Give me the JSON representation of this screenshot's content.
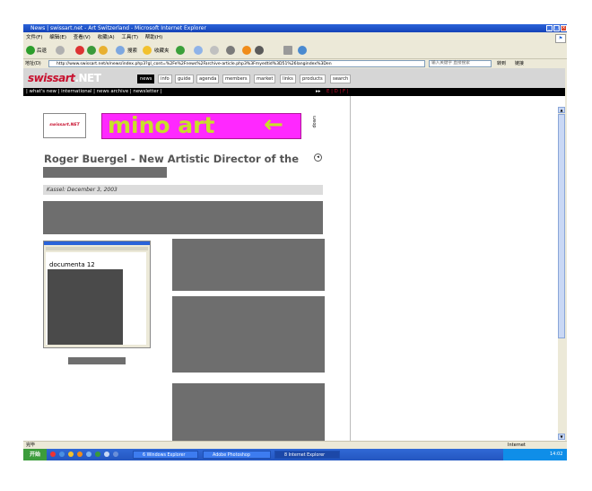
{
  "window": {
    "title": "News | swissart.net - Art Switzerland - Microsoft Internet Explorer"
  },
  "menu": [
    "文件(F)",
    "编辑(E)",
    "查看(V)",
    "收藏(A)",
    "工具(T)",
    "帮助(H)"
  ],
  "toolbar": {
    "back": "后退",
    "search": "搜索",
    "favorites": "收藏夹"
  },
  "address": {
    "label": "地址(D)",
    "url": "http://www.swissart.net/e/news/index.php3?gl_cont=%2Fe%2Fnews%2Farchive-article.php3%3Fmyedtid%3D51%26langindex%3Den",
    "search_placeholder": "输入关键字 直接搜索",
    "go": "转到",
    "links": "链接"
  },
  "site": {
    "logo_main": "swissart",
    "logo_ext": ".NET",
    "nav": [
      "news",
      "info",
      "guide",
      "agenda",
      "members",
      "market",
      "links",
      "products",
      "search"
    ],
    "subnav": "| what's new | international | news archive | newsletter |",
    "lang": "E | D | F |"
  },
  "article": {
    "small_logo": "swissart.NET",
    "banner": "mino art",
    "side_label": "down",
    "title": "Roger Buergel - New Artistic Director of the",
    "dateline": "Kassel: December 3, 2003",
    "image_caption": "documenta 12"
  },
  "status": {
    "left": "完毕",
    "zone": "Internet"
  },
  "taskbar": {
    "start": "开始",
    "tasks": [
      "6 Windows Explorer",
      "Adobe Photoshop",
      "8 Internet Explorer"
    ],
    "clock": "14:02"
  },
  "colors": {
    "banner_bg": "#ff28ff",
    "banner_text": "#c8e028",
    "brand_red": "#c8102e"
  }
}
